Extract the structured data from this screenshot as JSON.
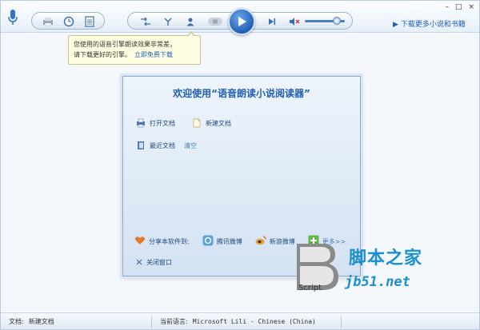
{
  "toolbar": {
    "icons": [
      "microphone-icon",
      "print-icon",
      "clock-icon",
      "list-icon",
      "shuffle-icon",
      "voice-icon",
      "person-icon",
      "stop-icon",
      "play-icon",
      "next-icon",
      "mute-icon"
    ],
    "volume_level": 0.8,
    "download_link": "下载更多小说和书籍",
    "window_controls": [
      "–",
      "□",
      "×"
    ]
  },
  "tooltip": {
    "line1": "您使用的语音引擎朗读效果非常差，",
    "line2": "请下载更好的引擎。",
    "link": "立即免费下载"
  },
  "dialog": {
    "title": "欢迎使用“语音朗读小说阅读器”",
    "open_doc": "打开文档",
    "new_doc": "新建文档",
    "recent_docs": "最近文档",
    "clear": "清空",
    "share_label": "分享本软件到:",
    "share_tencent": "腾讯微博",
    "share_sina": "新浪微博",
    "share_more": "更多>>",
    "close_window": "关闭窗口"
  },
  "watermark": {
    "cn": "脚本之家",
    "en": "jb51.net",
    "script": "Script"
  },
  "status": {
    "doc_label": "文档:",
    "doc_value": "新建文档",
    "lang_label": "当前语言:",
    "lang_value": "Microsoft Lili - Chinese (China)"
  },
  "colors": {
    "accent": "#1f5fb5",
    "watermark": "#1b8fd0",
    "tooltip_bg": "#fffde1"
  }
}
